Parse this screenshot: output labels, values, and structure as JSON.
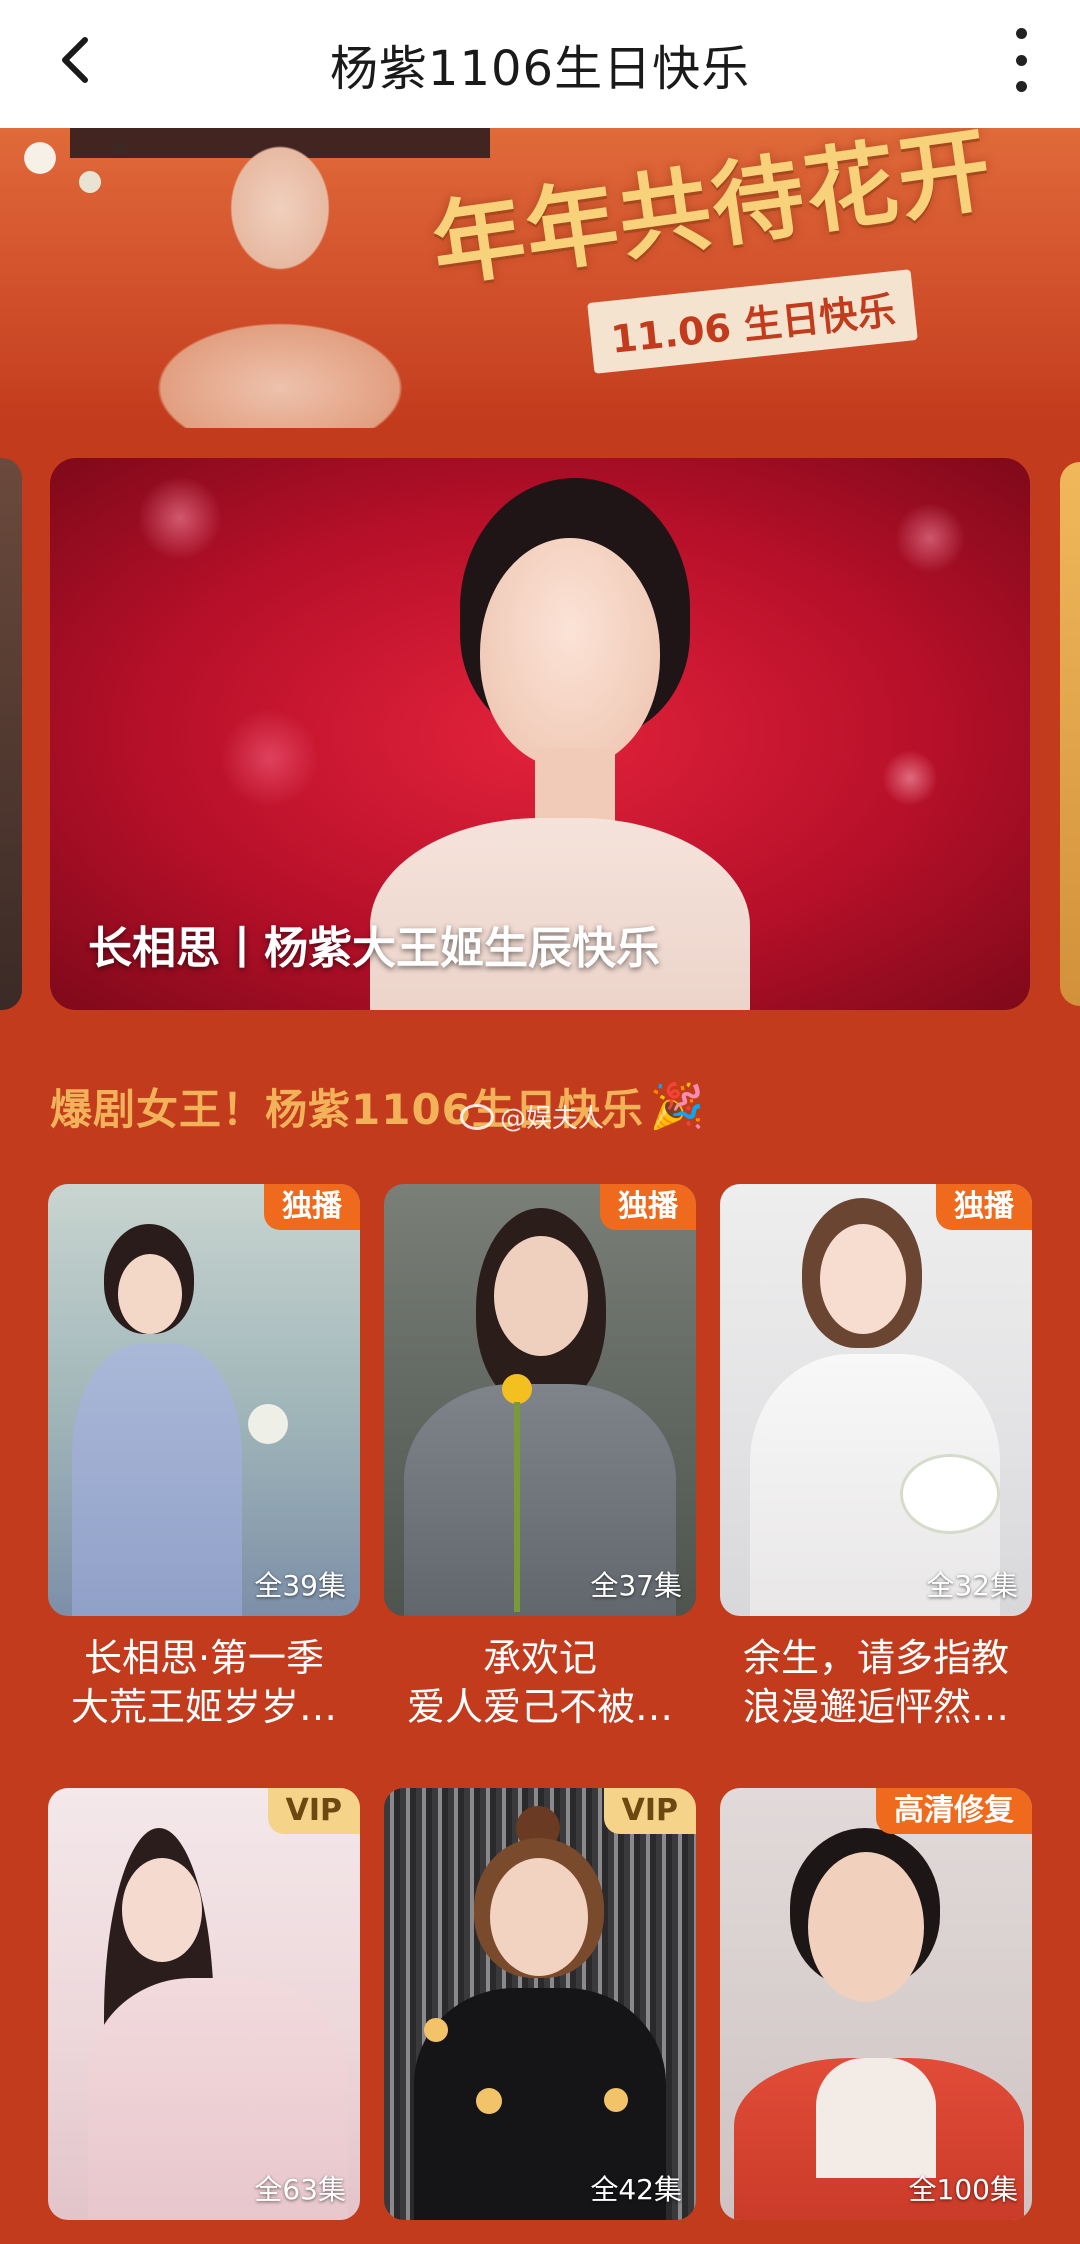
{
  "topbar": {
    "back_icon": "chevron-left-icon",
    "title": "杨紫1106生日快乐",
    "more_icon": "more-vertical-icon"
  },
  "banner": {
    "slogan": "年年共待花开",
    "date_text": "11.06 生日快乐"
  },
  "carousel": {
    "caption": "长相思丨杨紫大王姬生辰快乐"
  },
  "section": {
    "title": "爆剧女王！杨紫1106生日快乐",
    "party_icon": "🎉",
    "watermark": "@娱夫人"
  },
  "cards": [
    {
      "badge": "独播",
      "episodes": "全39集",
      "title": "长相思·第一季",
      "subtitle": "大荒王姬岁岁…"
    },
    {
      "badge": "独播",
      "episodes": "全37集",
      "title": "承欢记",
      "subtitle": "爱人爱己不被…"
    },
    {
      "badge": "独播",
      "episodes": "全32集",
      "title": "余生，请多指教",
      "subtitle": "浪漫邂逅怦然…"
    },
    {
      "badge": "VIP",
      "episodes": "全63集",
      "title": "",
      "subtitle": ""
    },
    {
      "badge": "VIP",
      "episodes": "全42集",
      "title": "",
      "subtitle": ""
    },
    {
      "badge": "高清修复",
      "episodes": "全100集",
      "title": "",
      "subtitle": ""
    }
  ],
  "colors": {
    "page_background": "#c23b1c",
    "section_title": "#f2b25a",
    "exclusive_badge": "#f06a1d",
    "vip_badge": "#f5d48a"
  }
}
